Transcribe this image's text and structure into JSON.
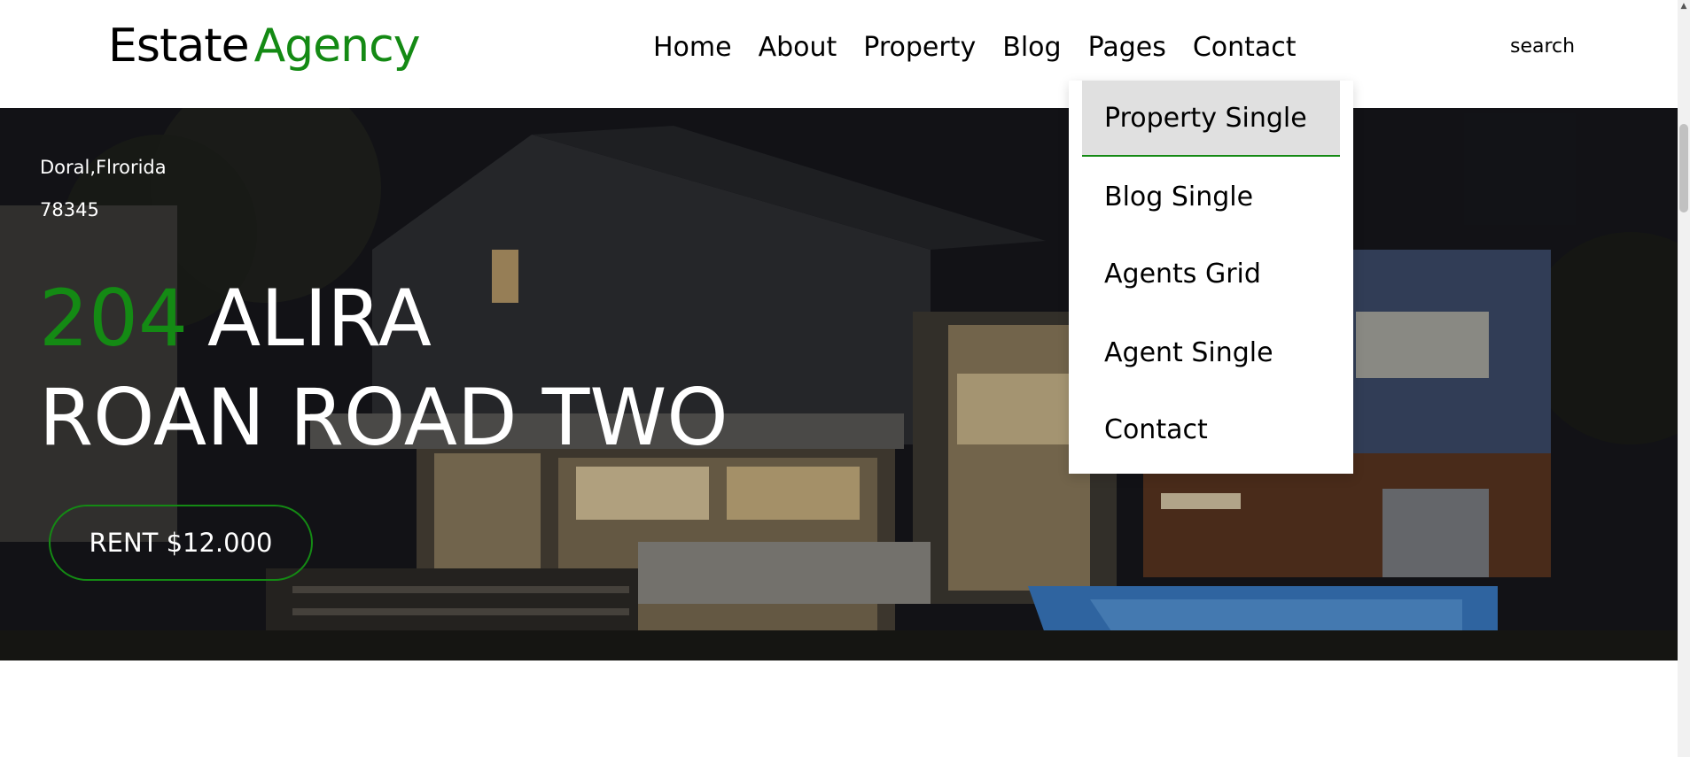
{
  "logo": {
    "part1": "Estate",
    "part2": "Agency"
  },
  "nav": {
    "items": [
      {
        "label": "Home"
      },
      {
        "label": "About"
      },
      {
        "label": "Property"
      },
      {
        "label": "Blog"
      },
      {
        "label": "Pages"
      },
      {
        "label": "Contact"
      }
    ],
    "search_label": "search"
  },
  "dropdown": {
    "items": [
      {
        "label": "Property Single",
        "active": true
      },
      {
        "label": "Blog Single"
      },
      {
        "label": "Agents Grid"
      },
      {
        "label": "Agent Single"
      },
      {
        "label": "Contact"
      }
    ]
  },
  "hero": {
    "address_line1": "Doral,Flrorida",
    "address_line2": "78345",
    "title_number": "204",
    "title_rest_line1": "ALIRA",
    "title_line2": "ROAN ROAD TWO",
    "cta_label": "RENT $12.000"
  },
  "colors": {
    "accent": "#148a14",
    "text_dark": "#000000",
    "text_light": "#ffffff"
  }
}
